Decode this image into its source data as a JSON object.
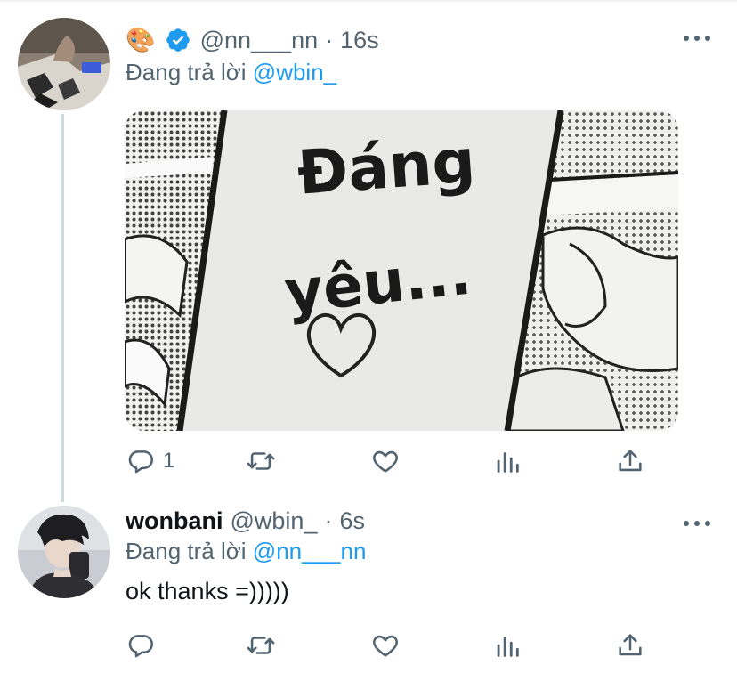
{
  "tweets": [
    {
      "display_name": "",
      "emoji": "🎨",
      "verified": true,
      "handle": "@nn___nn",
      "time": "16s",
      "reply_prefix": "Đang trả lời",
      "reply_to": "@wbin_",
      "text": "",
      "media": {
        "line1": "Đáng",
        "line2": "yêu...",
        "icon": "heart-doodle"
      },
      "stats": {
        "replies": "1",
        "retweets": "",
        "likes": ""
      }
    },
    {
      "display_name": "wonbani",
      "handle": "@wbin_",
      "time": "6s",
      "reply_prefix": "Đang trả lời",
      "reply_to": "@nn___nn",
      "text": "ok thanks =)))))",
      "stats": {
        "replies": "",
        "retweets": "",
        "likes": ""
      }
    }
  ],
  "icons": [
    "reply-icon",
    "retweet-icon",
    "like-icon",
    "stats-icon",
    "share-icon",
    "more-icon",
    "verified-icon"
  ],
  "colors": {
    "accent": "#1d9bf0",
    "muted": "#536471",
    "text": "#0f1419",
    "thread_line": "#cfd9de"
  }
}
